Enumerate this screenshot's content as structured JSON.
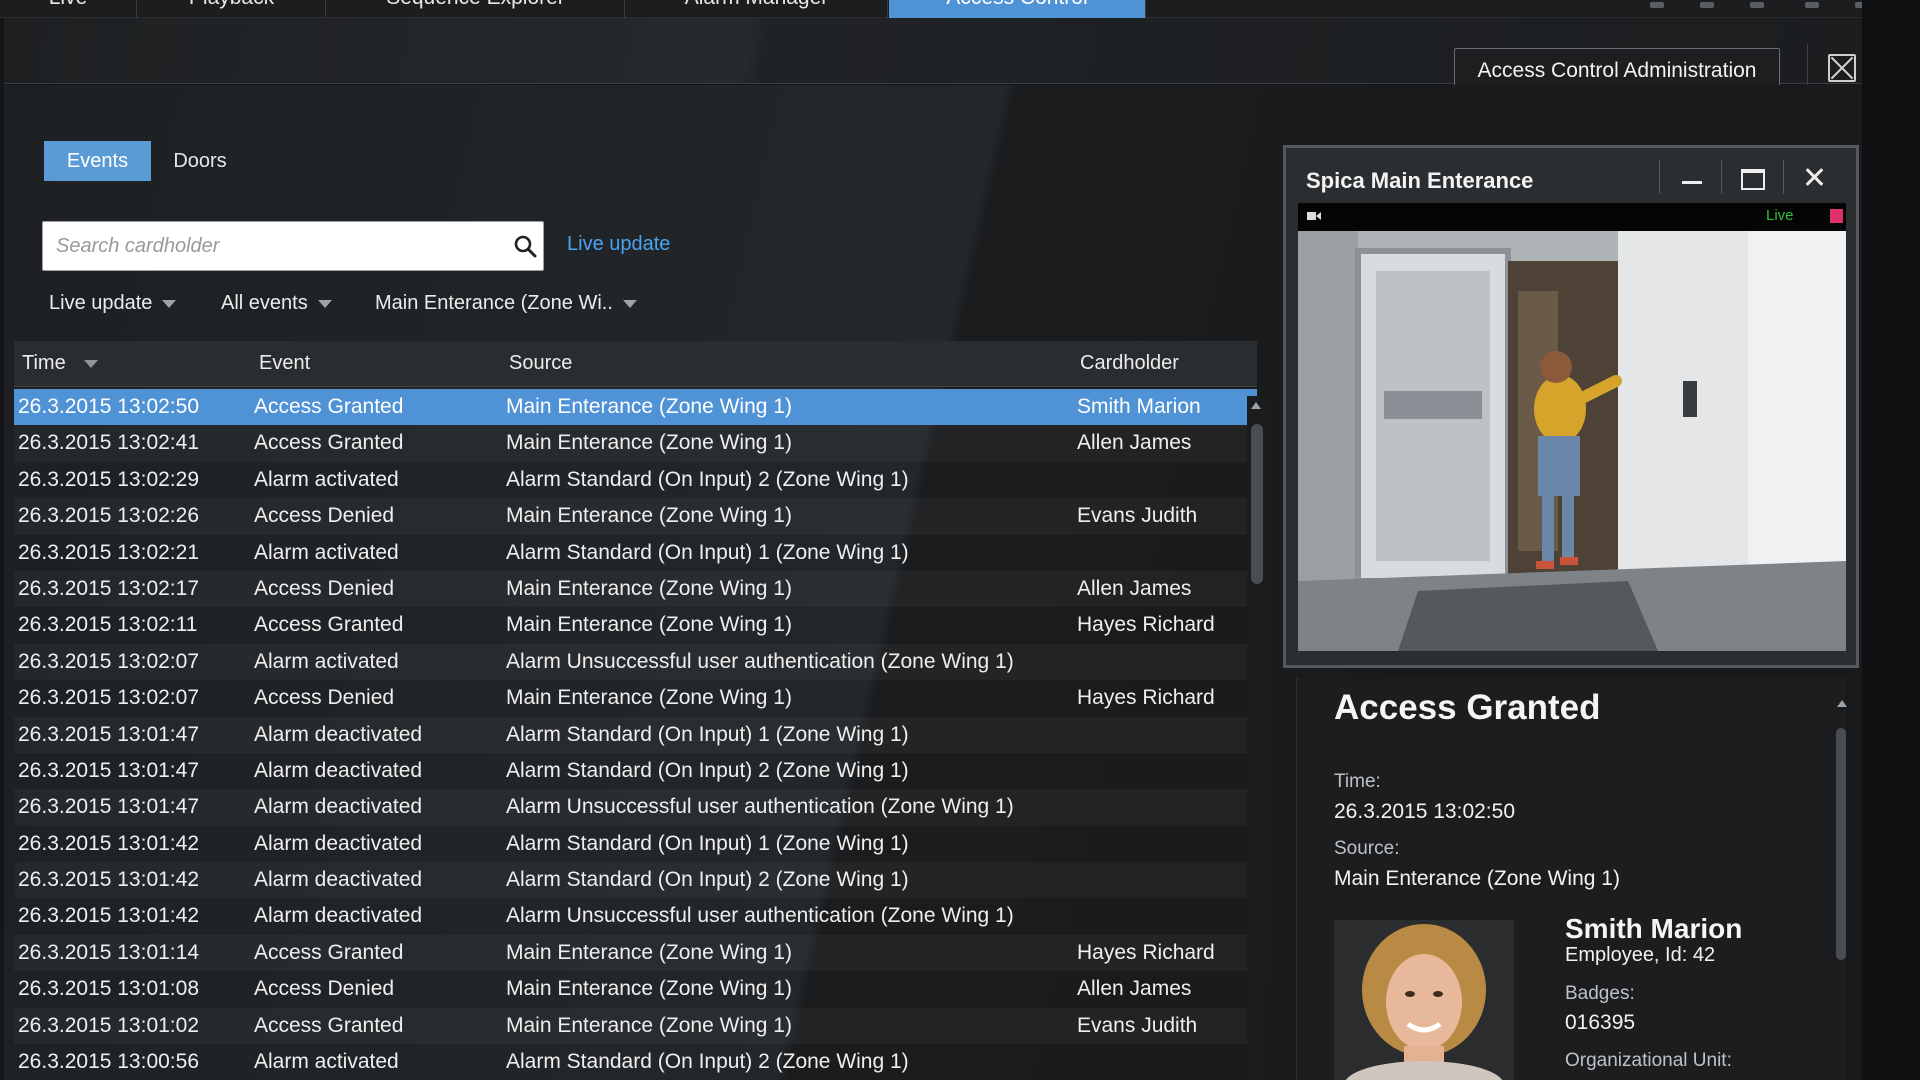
{
  "top_tabs": [
    {
      "label": "Live"
    },
    {
      "label": "Playback"
    },
    {
      "label": "Sequence Explorer"
    },
    {
      "label": "Alarm Manager"
    },
    {
      "label": "Access Control"
    }
  ],
  "header": {
    "admin_button": "Access Control Administration"
  },
  "sub_tabs": {
    "events": "Events",
    "doors": "Doors"
  },
  "search": {
    "placeholder": "Search cardholder",
    "live_update_link": "Live update"
  },
  "filters": {
    "update_mode": "Live update",
    "event_type": "All events",
    "source": "Main Enterance (Zone Wi.."
  },
  "table": {
    "headers": {
      "time": "Time",
      "event": "Event",
      "source": "Source",
      "cardholder": "Cardholder"
    },
    "rows": [
      {
        "time": "26.3.2015 13:02:50",
        "event": "Access Granted",
        "source": "Main Enterance (Zone Wing 1)",
        "cardholder": "Smith Marion"
      },
      {
        "time": "26.3.2015 13:02:41",
        "event": "Access Granted",
        "source": "Main Enterance (Zone Wing 1)",
        "cardholder": "Allen James"
      },
      {
        "time": "26.3.2015 13:02:29",
        "event": "Alarm activated",
        "source": "Alarm Standard (On Input) 2 (Zone Wing 1)",
        "cardholder": ""
      },
      {
        "time": "26.3.2015 13:02:26",
        "event": "Access Denied",
        "source": "Main Enterance (Zone Wing 1)",
        "cardholder": "Evans Judith"
      },
      {
        "time": "26.3.2015 13:02:21",
        "event": "Alarm activated",
        "source": "Alarm Standard (On Input) 1 (Zone Wing 1)",
        "cardholder": ""
      },
      {
        "time": "26.3.2015 13:02:17",
        "event": "Access Denied",
        "source": "Main Enterance (Zone Wing 1)",
        "cardholder": "Allen James"
      },
      {
        "time": "26.3.2015 13:02:11",
        "event": "Access Granted",
        "source": "Main Enterance (Zone Wing 1)",
        "cardholder": "Hayes Richard"
      },
      {
        "time": "26.3.2015 13:02:07",
        "event": "Alarm activated",
        "source": "Alarm Unsuccessful user authentication (Zone Wing 1)",
        "cardholder": ""
      },
      {
        "time": "26.3.2015 13:02:07",
        "event": "Access Denied",
        "source": "Main Enterance (Zone Wing 1)",
        "cardholder": "Hayes Richard"
      },
      {
        "time": "26.3.2015 13:01:47",
        "event": "Alarm deactivated",
        "source": "Alarm Standard (On Input) 1 (Zone Wing 1)",
        "cardholder": ""
      },
      {
        "time": "26.3.2015 13:01:47",
        "event": "Alarm deactivated",
        "source": "Alarm Standard (On Input) 2 (Zone Wing 1)",
        "cardholder": ""
      },
      {
        "time": "26.3.2015 13:01:47",
        "event": "Alarm deactivated",
        "source": "Alarm Unsuccessful user authentication (Zone Wing 1)",
        "cardholder": ""
      },
      {
        "time": "26.3.2015 13:01:42",
        "event": "Alarm deactivated",
        "source": "Alarm Standard (On Input) 1 (Zone Wing 1)",
        "cardholder": ""
      },
      {
        "time": "26.3.2015 13:01:42",
        "event": "Alarm deactivated",
        "source": "Alarm Standard (On Input) 2 (Zone Wing 1)",
        "cardholder": ""
      },
      {
        "time": "26.3.2015 13:01:42",
        "event": "Alarm deactivated",
        "source": "Alarm Unsuccessful user authentication (Zone Wing 1)",
        "cardholder": ""
      },
      {
        "time": "26.3.2015 13:01:14",
        "event": "Access Granted",
        "source": "Main Enterance (Zone Wing 1)",
        "cardholder": "Hayes Richard"
      },
      {
        "time": "26.3.2015 13:01:08",
        "event": "Access Denied",
        "source": "Main Enterance (Zone Wing 1)",
        "cardholder": "Allen James"
      },
      {
        "time": "26.3.2015 13:01:02",
        "event": "Access Granted",
        "source": "Main Enterance (Zone Wing 1)",
        "cardholder": "Evans Judith"
      },
      {
        "time": "26.3.2015 13:00:56",
        "event": "Alarm activated",
        "source": "Alarm Standard (On Input) 2 (Zone Wing 1)",
        "cardholder": ""
      }
    ]
  },
  "video": {
    "title": "Spica Main Enterance",
    "status": "Live"
  },
  "detail": {
    "title": "Access Granted",
    "time_label": "Time:",
    "time_value": "26.3.2015 13:02:50",
    "source_label": "Source:",
    "source_value": "Main Enterance (Zone Wing 1)",
    "name": "Smith Marion",
    "role": "Employee, Id: 42",
    "badges_label": "Badges:",
    "badges_value": "016395",
    "org_label": "Organizational Unit:"
  },
  "colors": {
    "accent": "#4f93d6",
    "link": "#4aa3f0",
    "live": "#2fbf3a",
    "record": "#e0306a"
  }
}
